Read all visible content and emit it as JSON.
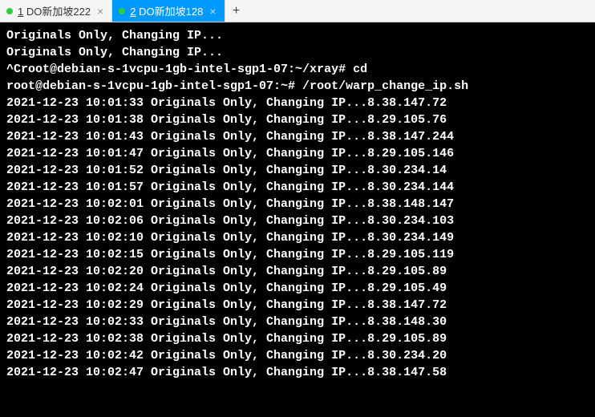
{
  "tabs": [
    {
      "indicator": "●",
      "num": "1",
      "label": "DO新加坡222",
      "active": false
    },
    {
      "indicator": "●",
      "num": "2",
      "label": "DO新加坡128",
      "active": true
    }
  ],
  "new_tab_label": "+",
  "close_glyph": "×",
  "terminal": {
    "pre_lines": [
      "Originals Only, Changing IP...",
      "Originals Only, Changing IP...",
      "^Croot@debian-s-1vcpu-1gb-intel-sgp1-07:~/xray# cd",
      "root@debian-s-1vcpu-1gb-intel-sgp1-07:~# /root/warp_change_ip.sh"
    ],
    "log_prefix": "Originals Only, Changing IP...",
    "entries": [
      {
        "ts": "2021-12-23 10:01:33",
        "ip": "8.38.147.72"
      },
      {
        "ts": "2021-12-23 10:01:38",
        "ip": "8.29.105.76"
      },
      {
        "ts": "2021-12-23 10:01:43",
        "ip": "8.38.147.244"
      },
      {
        "ts": "2021-12-23 10:01:47",
        "ip": "8.29.105.146"
      },
      {
        "ts": "2021-12-23 10:01:52",
        "ip": "8.30.234.14"
      },
      {
        "ts": "2021-12-23 10:01:57",
        "ip": "8.30.234.144"
      },
      {
        "ts": "2021-12-23 10:02:01",
        "ip": "8.38.148.147"
      },
      {
        "ts": "2021-12-23 10:02:06",
        "ip": "8.30.234.103"
      },
      {
        "ts": "2021-12-23 10:02:10",
        "ip": "8.30.234.149"
      },
      {
        "ts": "2021-12-23 10:02:15",
        "ip": "8.29.105.119"
      },
      {
        "ts": "2021-12-23 10:02:20",
        "ip": "8.29.105.89"
      },
      {
        "ts": "2021-12-23 10:02:24",
        "ip": "8.29.105.49"
      },
      {
        "ts": "2021-12-23 10:02:29",
        "ip": "8.38.147.72"
      },
      {
        "ts": "2021-12-23 10:02:33",
        "ip": "8.38.148.30"
      },
      {
        "ts": "2021-12-23 10:02:38",
        "ip": "8.29.105.89"
      },
      {
        "ts": "2021-12-23 10:02:42",
        "ip": "8.30.234.20"
      },
      {
        "ts": "2021-12-23 10:02:47",
        "ip": "8.38.147.58"
      }
    ]
  }
}
